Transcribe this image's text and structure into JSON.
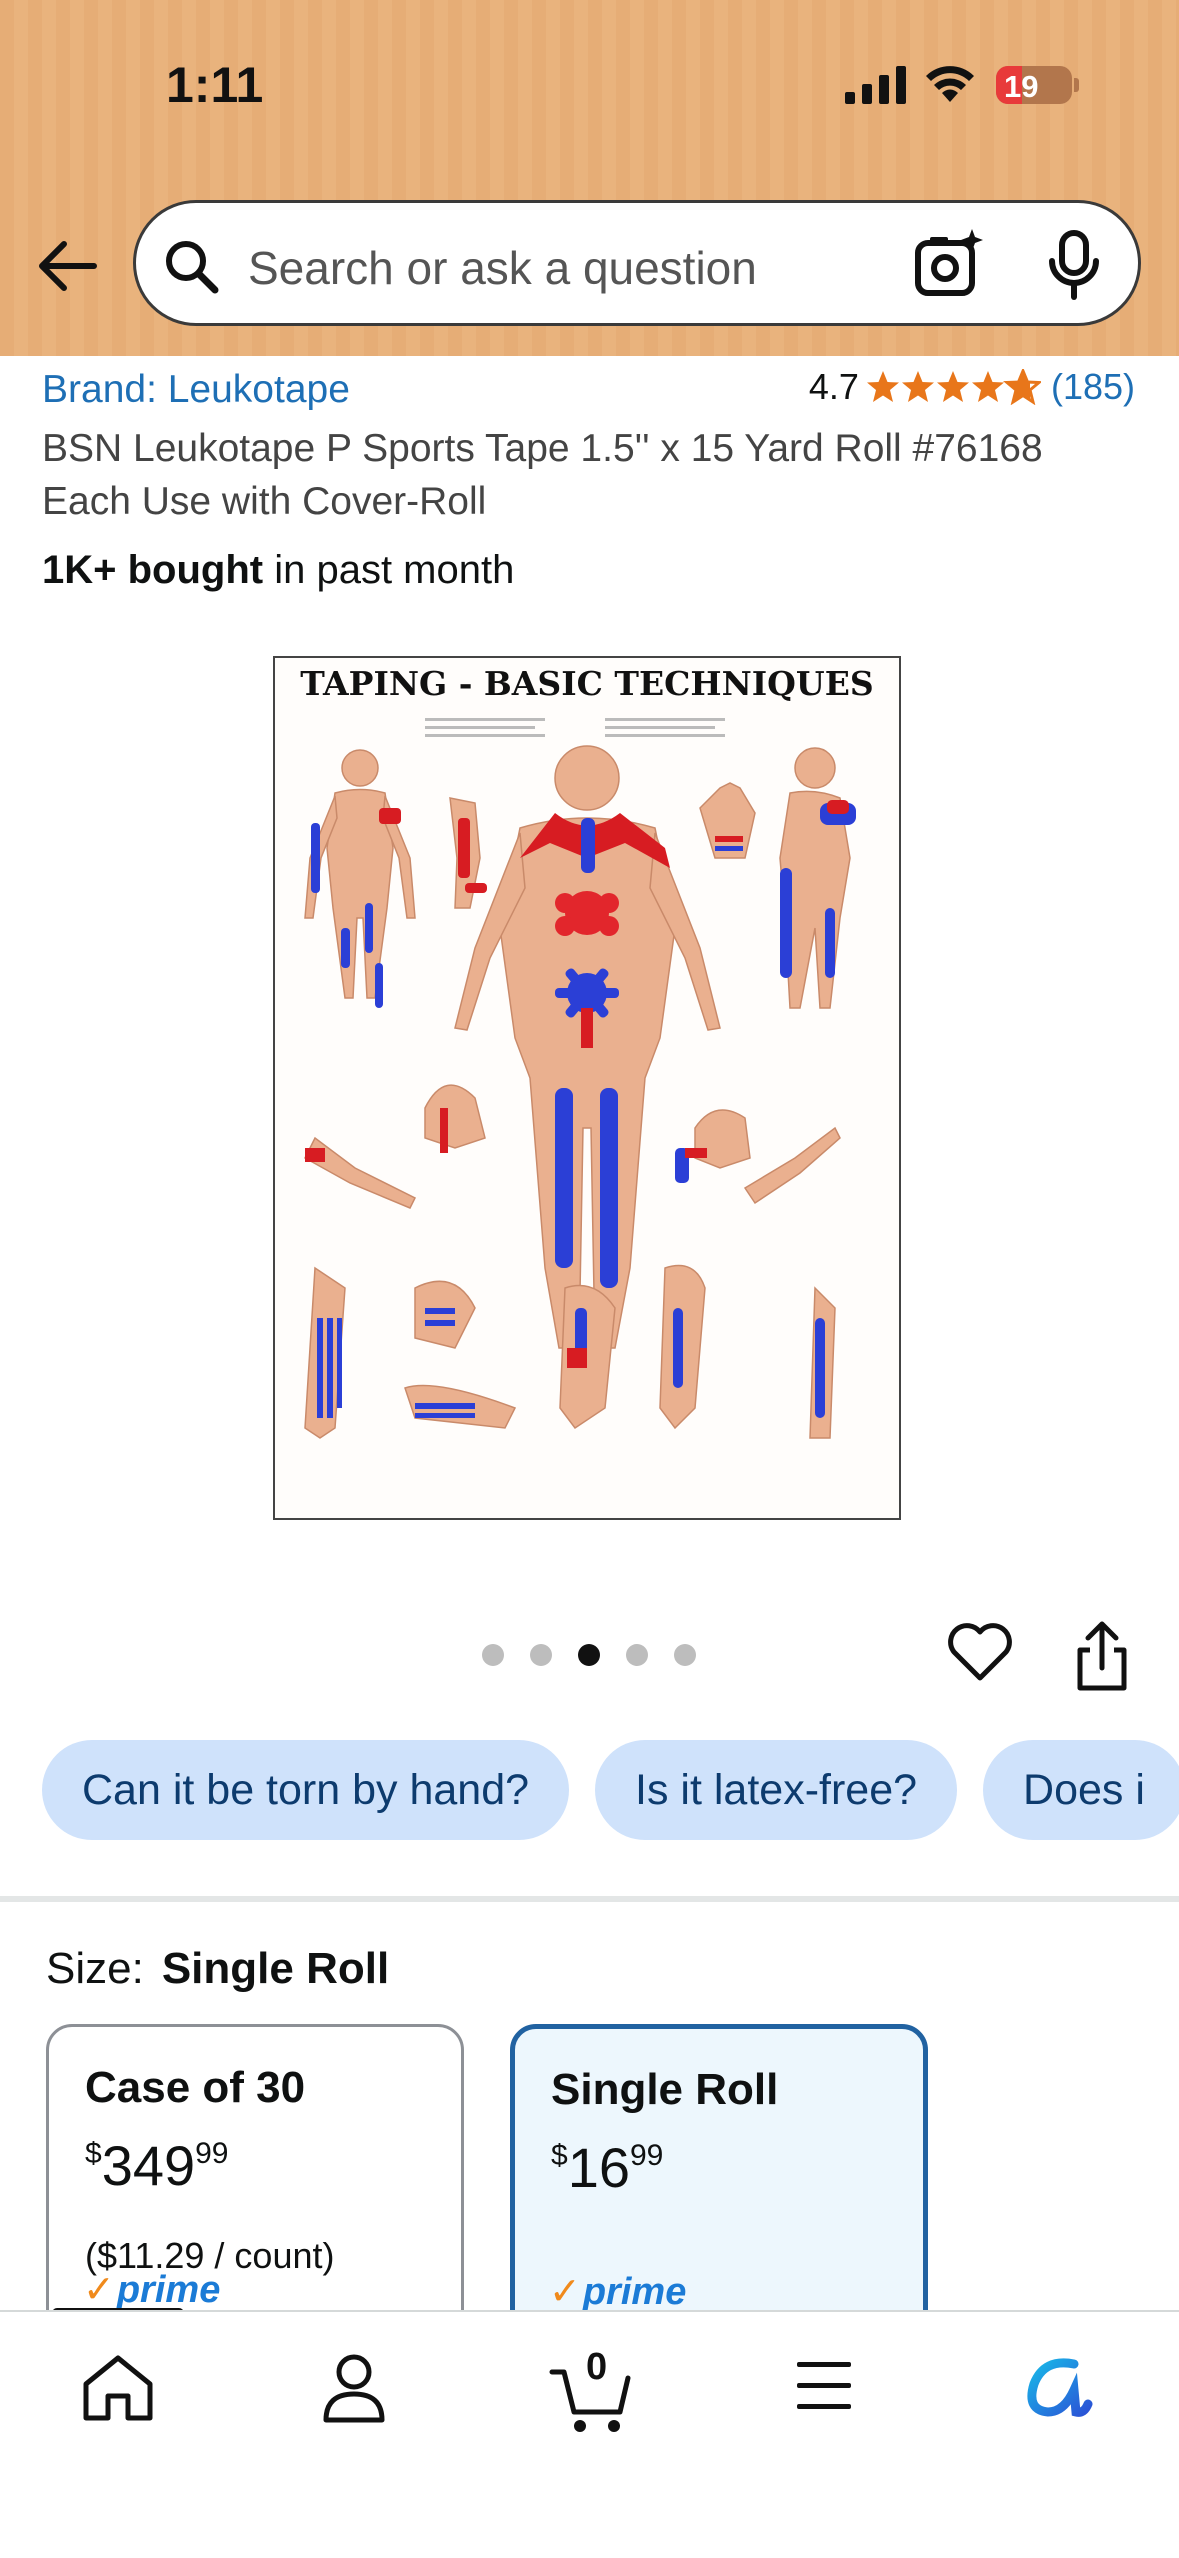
{
  "status_bar": {
    "time": "1:11",
    "battery": "19"
  },
  "search": {
    "placeholder": "Search or ask a question"
  },
  "product": {
    "brand": "Brand: Leukotape",
    "rating_value": "4.7",
    "rating_count": "(185)",
    "rating_stars": 4.7,
    "title": "BSN Leukotape P Sports Tape 1.5'' x 15 Yard Roll #76168 Each Use with Cover-Roll",
    "bought_bold": "1K+ bought",
    "bought_rest": " in past month",
    "image_title": "TAPING - BASIC TECHNIQUES"
  },
  "gallery": {
    "image_count": 5,
    "active_index": 2
  },
  "chips": [
    "Can it be torn by hand?",
    "Is it latex-free?",
    "Does i"
  ],
  "size": {
    "label": "Size:",
    "selected": "Single Roll",
    "options": [
      {
        "name": "Case of 30",
        "price_symbol": "$",
        "price_whole": "349",
        "price_fraction": "99",
        "unit_price": "($11.29 / count)",
        "prime": "prime"
      },
      {
        "name": "Single Roll",
        "price_symbol": "$",
        "price_whole": "16",
        "price_fraction": "99",
        "unit_price": "",
        "prime": "prime"
      }
    ]
  },
  "nav": {
    "cart_count": "0"
  },
  "colors": {
    "header": "#e6ad76",
    "link": "#1e6fb5",
    "chip": "#cfe2fb",
    "selected_border": "#2162a1",
    "star": "#e8761a",
    "prime": "#1b7bd6"
  }
}
